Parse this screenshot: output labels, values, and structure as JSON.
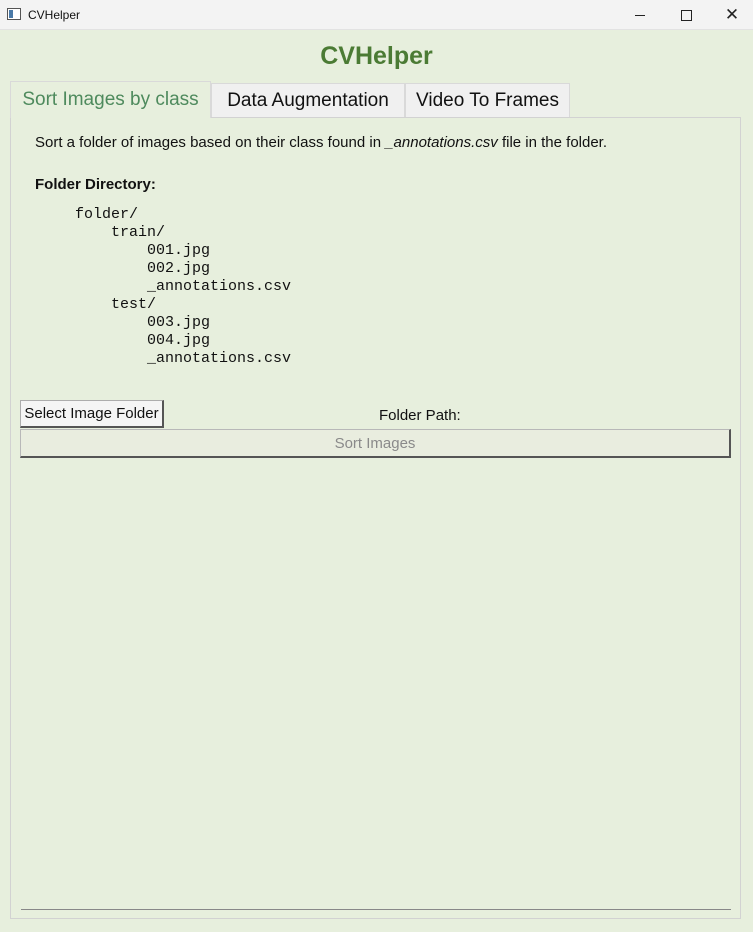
{
  "window": {
    "title": "CVHelper",
    "icon": "app-window-icon",
    "controls": {
      "minimize": "minimize-icon",
      "maximize": "maximize-icon",
      "close": "close-icon"
    }
  },
  "header": {
    "title": "CVHelper"
  },
  "tabs": [
    {
      "label": "Sort Images by class",
      "active": true
    },
    {
      "label": "Data Augmentation",
      "active": false
    },
    {
      "label": "Video To Frames",
      "active": false
    }
  ],
  "sort_tab": {
    "description_prefix": "Sort a folder of images based on their class found in ",
    "description_file": "_annotations.csv",
    "description_suffix": " file in the folder.",
    "folder_directory_heading": "Folder Directory:",
    "tree": [
      "folder/",
      "    train/",
      "        001.jpg",
      "        002.jpg",
      "        _annotations.csv",
      "    test/",
      "        003.jpg",
      "        004.jpg",
      "        _annotations.csv"
    ],
    "select_folder_label": "Select Image Folder",
    "folder_path_label": "Folder Path:",
    "sort_button_label": "Sort Images"
  },
  "colors": {
    "background": "#e7efdd",
    "accent": "#4b7b34",
    "active_tab_text": "#4e8a5d",
    "disabled_text": "#8a8a8a"
  }
}
